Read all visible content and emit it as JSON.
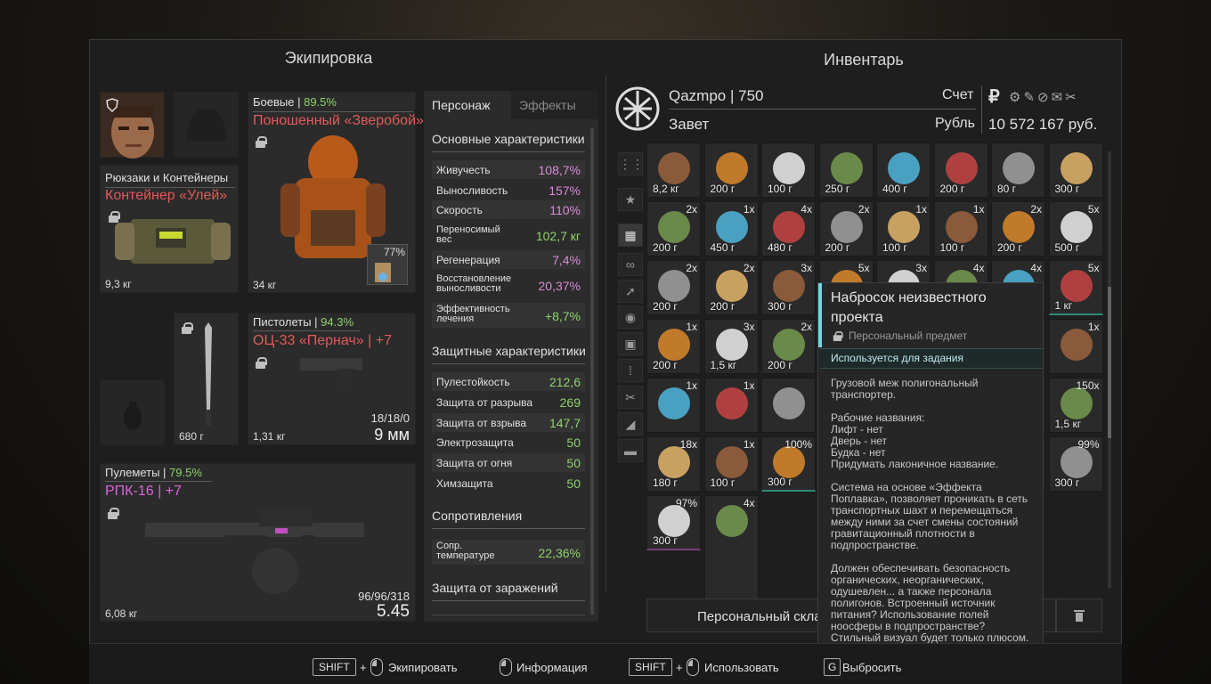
{
  "equipment": {
    "title": "Экипировка",
    "backpack": {
      "category": "Рюкзаки и Контейнеры",
      "name": "Контейнер «Улей»",
      "weight": "9,3 кг"
    },
    "armor": {
      "category": "Боевые",
      "condition": "89.5%",
      "name": "Поношенный «Зверобой»",
      "weight": "34 кг",
      "container_pct": "77%"
    },
    "melee": {
      "weight": "680 г"
    },
    "pistol": {
      "category": "Пистолеты",
      "condition": "94.3%",
      "name": "ОЦ-33 «Пернач»",
      "upgrade": "| +7",
      "weight": "1,31 кг",
      "ammo": "18/18/0",
      "caliber": "9 мм"
    },
    "mg": {
      "category": "Пулеметы",
      "condition": "79.5%",
      "name": "РПК-16",
      "upgrade": "| +7",
      "weight": "6,08 кг",
      "ammo": "96/96/318",
      "caliber": "5.45"
    }
  },
  "character": {
    "tabs": [
      "Персонаж",
      "Эффекты"
    ],
    "sections": {
      "main": "Основные характеристики",
      "protect": "Защитные характеристики",
      "resist": "Сопротивления",
      "infection": "Защита от заражений"
    },
    "main_stats": [
      {
        "label": "Живучесть",
        "value": "108,7%"
      },
      {
        "label": "Выносливость",
        "value": "157%"
      },
      {
        "label": "Скорость",
        "value": "110%"
      },
      {
        "label": "Переносимый вес",
        "value": "102,7 кг"
      },
      {
        "label": "Регенерация",
        "value": "7,4%"
      },
      {
        "label": "Восстановление выносливости",
        "value": "20,37%"
      },
      {
        "label": "Эффективность лечения",
        "value": "+8,7%"
      }
    ],
    "protect_stats": [
      {
        "label": "Пулестойкость",
        "value": "212,6"
      },
      {
        "label": "Защита от разрыва",
        "value": "269"
      },
      {
        "label": "Защита от взрыва",
        "value": "147,7"
      },
      {
        "label": "Электрозащита",
        "value": "50"
      },
      {
        "label": "Защита от огня",
        "value": "50"
      },
      {
        "label": "Химзащита",
        "value": "50"
      }
    ],
    "resist_stats": [
      {
        "label": "Сопр. температуре",
        "value": "22,36%"
      }
    ]
  },
  "inventory": {
    "title": "Инвентарь",
    "player": "Qazmpo | 750",
    "faction": "Завет",
    "account_label": "Счет",
    "currency_label": "Рубль",
    "ruble_symbol": "₽",
    "balance": "10 572 167 руб.",
    "stash_label": "Персональный склад",
    "rows": [
      [
        {
          "w": "8,2 кг"
        },
        {
          "w": "200 г"
        },
        {
          "w": "100 г"
        },
        {
          "w": "250 г"
        },
        {
          "w": "400 г"
        },
        {
          "w": "200 г"
        },
        {
          "w": "80 г"
        },
        {
          "w": "300 г"
        }
      ],
      [
        {
          "q": "2x",
          "w": "200 г"
        },
        {
          "q": "1x",
          "w": "450 г"
        },
        {
          "q": "4x",
          "w": "480 г"
        },
        {
          "q": "2x",
          "w": "200 г"
        },
        {
          "q": "1x",
          "w": "100 г"
        },
        {
          "q": "1x",
          "w": "100 г"
        },
        {
          "q": "2x",
          "w": "200 г"
        },
        {
          "q": "5x",
          "w": "500 г"
        }
      ],
      [
        {
          "q": "2x",
          "w": "200 г"
        },
        {
          "q": "2x",
          "w": "200 г"
        },
        {
          "q": "3x",
          "w": "300 г"
        },
        {
          "q": "5x",
          "w": ""
        },
        {
          "q": "3x",
          "w": ""
        },
        {
          "q": "4x",
          "w": ""
        },
        {
          "q": "4x",
          "w": ""
        },
        {
          "q": "5x",
          "w": "1 кг"
        }
      ],
      [
        {
          "q": "1x",
          "w": "200 г"
        },
        {
          "q": "3x",
          "w": "1,5 кг"
        },
        {
          "q": "2x",
          "w": "200 г"
        },
        {
          "w": ""
        },
        {
          "w": ""
        },
        {
          "w": ""
        },
        {
          "w": ""
        },
        {
          "q": "1x",
          "w": ""
        }
      ],
      [
        {
          "q": "1x",
          "w": ""
        },
        {
          "q": "1x",
          "w": ""
        },
        {
          "w": ""
        },
        {
          "w": ""
        },
        {
          "w": ""
        },
        {
          "w": ""
        },
        {
          "w": ""
        },
        {
          "q": "150x",
          "w": "1,5 кг"
        }
      ],
      [
        {
          "q": "18x",
          "w": "180 г"
        },
        {
          "q": "1x",
          "w": "100 г"
        },
        {
          "q": "100%",
          "w": "300 г"
        },
        {
          "w": ""
        },
        {
          "w": ""
        },
        {
          "w": ""
        },
        {
          "w": ""
        },
        {
          "q": "99%",
          "w": "300 г"
        }
      ],
      [
        {
          "q": "97%",
          "w": "300 г"
        },
        {
          "q": "4x",
          "w": ""
        }
      ]
    ]
  },
  "tooltip": {
    "title": "Набросок неизвестного проекта",
    "subtitle": "Персональный предмет",
    "quest_label": "Используется для задания",
    "desc1": "Грузовой меж полигональный\nтранспортер.",
    "desc2": "Рабочие названия:\nЛифт - нет\nДверь - нет\nБудка - нет\nПридумать лаконичное название.",
    "desc3": "Система на основе «Эффекта\nПоплавка», позволяет проникать в сеть\nтранспортных шахт и перемещаться\nмежду ними за счет смены состояний\nгравитационный плотности в\nподпространстве.",
    "desc4": "Должен обеспечивать безопасность\nорганических, неорганических,\nодушевлен... а также персонала\nполигонов. Встроенный источник\nпитания? Использование полей\nноосферы в подпространстве?\nСтильный визуал будет только плюсом."
  },
  "footer": {
    "shift": "SHIFT",
    "plus": "+",
    "equip": "Экипировать",
    "info": "Информация",
    "use": "Использовать",
    "drop_key": "G",
    "drop": "Выбросить"
  },
  "colors": {
    "accent_red": "#e05a5a",
    "accent_pink": "#d866d8",
    "accent_green": "#8fd36b",
    "tooltip_accent": "#6fd6e8"
  }
}
